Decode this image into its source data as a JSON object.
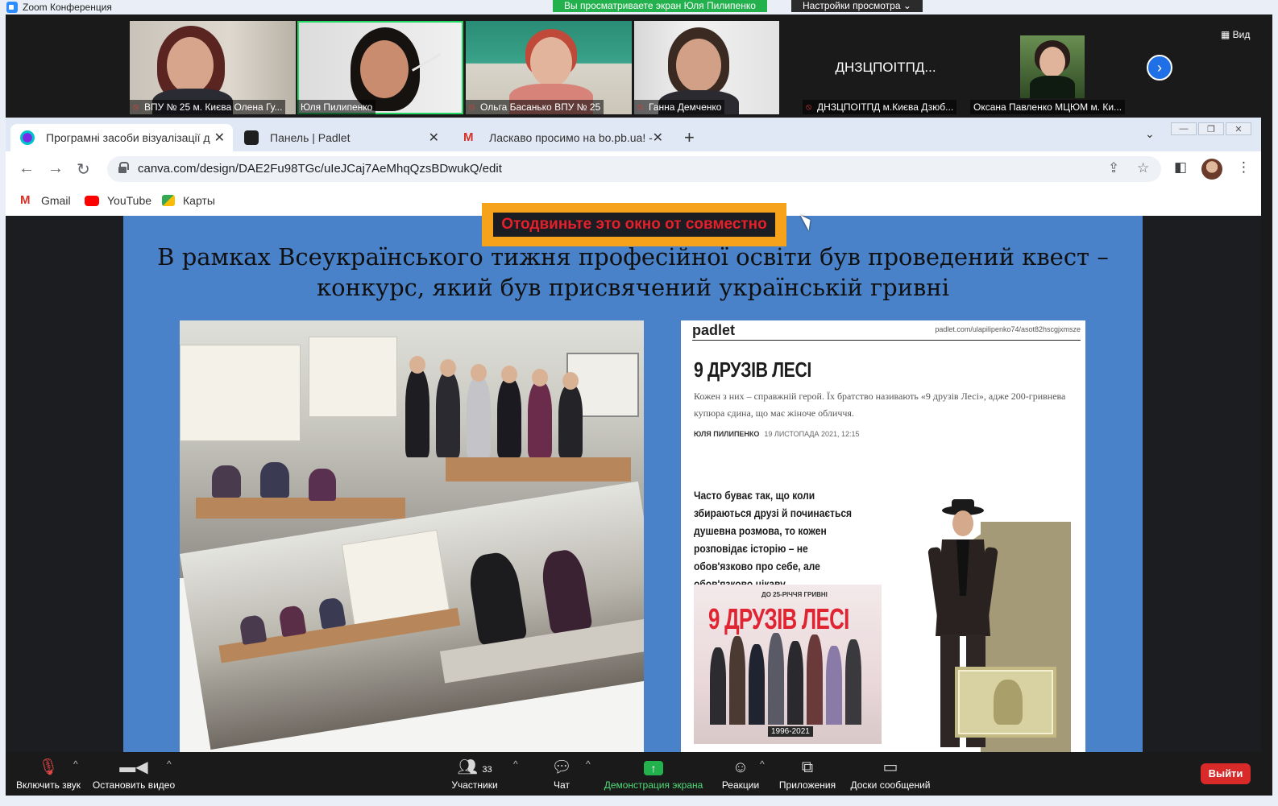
{
  "zoom": {
    "window_title": "Zoom Конференция",
    "share_banner": "Вы просматриваете экран Юля Пилипенко",
    "view_settings": "Настройки просмотра ⌄",
    "view_button": "Вид",
    "participants": [
      {
        "name": "ВПУ № 25 м. Києва Олена Гу...",
        "muted": true
      },
      {
        "name": "Юля Пилипенко",
        "muted": false,
        "active": true
      },
      {
        "name": "Ольга Басанько ВПУ № 25",
        "muted": true
      },
      {
        "name": "Ганна Демченко",
        "muted": true
      },
      {
        "name": "ДНЗЦПОІТПД м.Києва Дзюб...",
        "muted": true,
        "display_text": "ДНЗЦПОІТПД..."
      },
      {
        "name": "Оксана Павленко МЦЮМ м. Ки...",
        "muted": false
      }
    ],
    "toolbar": {
      "unmute": "Включить звук",
      "stop_video": "Остановить видео",
      "participants": "Участники",
      "participants_count": "33",
      "chat": "Чат",
      "share_screen": "Демонстрация экрана",
      "reactions": "Реакции",
      "apps": "Приложения",
      "whiteboards": "Доски сообщений",
      "leave": "Выйти"
    }
  },
  "browser": {
    "tabs": [
      {
        "title": "Програмні засоби візуалізації д",
        "active": true
      },
      {
        "title": "Панель | Padlet",
        "active": false
      },
      {
        "title": "Ласкаво просимо на bo.pb.ua! -",
        "active": false
      }
    ],
    "url": "canva.com/design/DAE2Fu98TGc/uIeJCaj7AeMhqQzsBDwukQ/edit",
    "bookmarks": [
      "Gmail",
      "YouTube",
      "Карты"
    ]
  },
  "slide": {
    "title": "В рамках Всеукраїнського тижня професійної освіти був проведений квест – конкурс, який був присвячений українській гривні",
    "padlet": {
      "logo": "padlet",
      "url": "padlet.com/ulapilipenko74/asot82hscgjxmsze",
      "title": "9 ДРУЗІВ ЛЕСІ",
      "lead": "Кожен з них – справжній герой. Їх братство називають «9 друзів Лесі», адже 200-гривнева купюра єдина, що має жіноче обличчя.",
      "author": "ЮЛЯ ПИЛИПЕНКО",
      "date": "19 ЛИСТОПАДА 2021, 12:15",
      "body": "Часто буває так, що коли збираються друзі й починається душевна розмова, то кожен розповідає історію – не обов'язково про себе, але обов'язково цікаву.",
      "poster_kicker": "ДО 25-РІЧЧЯ ГРИВНІ",
      "poster_title": "9 ДРУЗІВ ЛЕСІ",
      "poster_years": "1996-2021"
    }
  },
  "overlay": {
    "warning": "Отодвиньте это окно от совместно"
  },
  "colors": {
    "zoom_green": "#23b14d",
    "slide_blue": "#4a82c9",
    "warning_orange": "#f7a21b",
    "warning_text": "#e5202a",
    "leave_red": "#d92a2a"
  }
}
